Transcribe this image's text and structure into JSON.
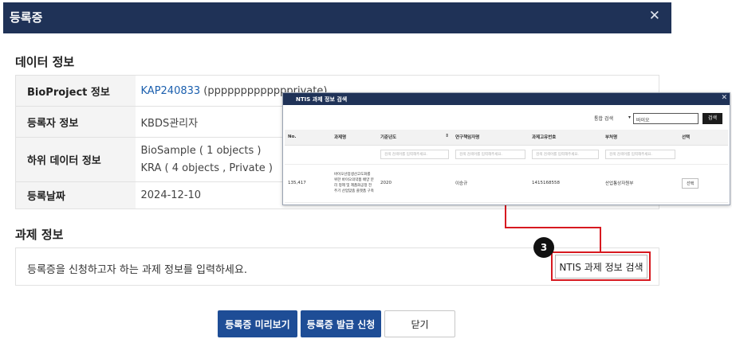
{
  "modal": {
    "title": "등록증",
    "close_icon": "close-icon"
  },
  "data_section": {
    "title": "데이터 정보",
    "rows": {
      "bioproject": {
        "label": "BioProject 정보",
        "link": "KAP240833",
        "suffix": "(ppppppppppppprivate)"
      },
      "registrant": {
        "label": "등록자 정보",
        "value": "KBDS관리자"
      },
      "sub_data": {
        "label": "하위 데이터 정보",
        "lines": [
          "BioSample ( 1 objects )",
          "KRA ( 4 objects , Private )"
        ]
      },
      "date": {
        "label": "등록날짜",
        "value": "2024-12-10"
      }
    }
  },
  "task_section": {
    "title": "과제 정보",
    "description": "등록증을 신청하고자 하는 과제 정보를 입력하세요.",
    "search_button": "NTIS 과제 정보 검색",
    "callout_number": "3"
  },
  "footer": {
    "preview_button": "등록증 미리보기",
    "issue_button": "등록증 발급 신청",
    "close_button": "닫기"
  },
  "popup": {
    "title": "NTIS 과제 정보 검색",
    "search_type": "통합 검색",
    "search_value": "바이오",
    "search_button": "검색",
    "filter_placeholder": "검색 검색어를 입력해주세요.",
    "columns": [
      "No.",
      "과제명",
      "기준년도",
      "연구책임자명",
      "과제고유번호",
      "부처명",
      "선택"
    ],
    "rows": [
      {
        "no": "135,417",
        "title": "바이오산업생산고도화를 위한 바이오의약품 배양 분리 정제 및 제품화공정 전주기 산업맞춤 플랫폼 구축",
        "year": "2020",
        "researcher": "이승규",
        "project_id": "1415168558",
        "ministry": "산업통상자원부",
        "select_label": "선택"
      }
    ]
  }
}
